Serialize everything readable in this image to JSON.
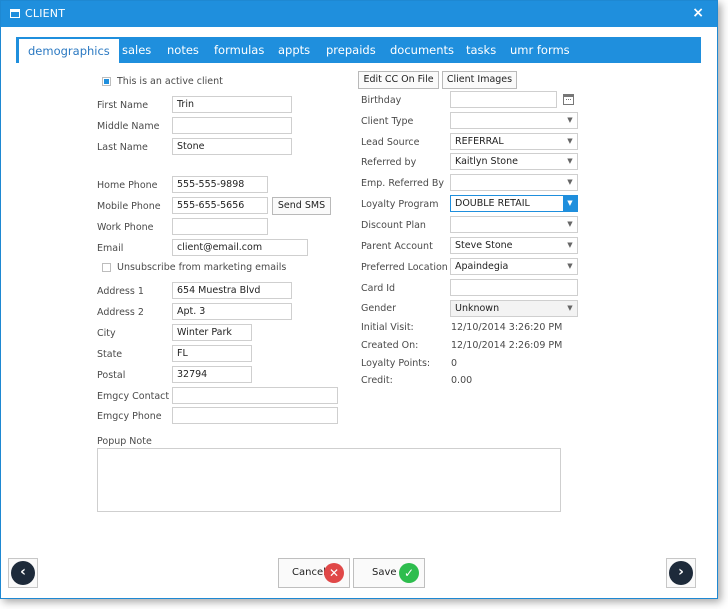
{
  "window": {
    "title": "CLIENT",
    "close": "×"
  },
  "tabs": [
    "demographics",
    "sales",
    "notes",
    "formulas",
    "appts",
    "prepaids",
    "documents",
    "tasks",
    "umr forms"
  ],
  "left": {
    "active_client": "This is an active client",
    "first_name_label": "First Name",
    "first_name": "Trin",
    "middle_name_label": "Middle Name",
    "middle_name": "",
    "last_name_label": "Last Name",
    "last_name": "Stone",
    "home_phone_label": "Home Phone",
    "home_phone": "555-555-9898",
    "mobile_phone_label": "Mobile Phone",
    "mobile_phone": "555-655-5656",
    "send_sms": "Send SMS",
    "work_phone_label": "Work Phone",
    "work_phone": "",
    "email_label": "Email",
    "email": "client@email.com",
    "unsubscribe": "Unsubscribe from marketing emails",
    "address1_label": "Address 1",
    "address1": "654 Muestra Blvd",
    "address2_label": "Address 2",
    "address2": "Apt. 3",
    "city_label": "City",
    "city": "Winter Park",
    "state_label": "State",
    "state": "FL",
    "postal_label": "Postal",
    "postal": "32794",
    "emgcy_contact_label": "Emgcy Contact",
    "emgcy_contact": "",
    "emgcy_phone_label": "Emgcy Phone",
    "emgcy_phone": "",
    "popup_note_label": "Popup Note"
  },
  "right": {
    "edit_cc": "Edit CC On File",
    "client_images": "Client Images",
    "birthday_label": "Birthday",
    "birthday": "",
    "client_type_label": "Client Type",
    "client_type": "",
    "lead_source_label": "Lead Source",
    "lead_source": "REFERRAL",
    "referred_by_label": "Referred by",
    "referred_by": "Kaitlyn Stone",
    "emp_referred_label": "Emp. Referred By",
    "emp_referred": "",
    "loyalty_program_label": "Loyalty Program",
    "loyalty_program": "DOUBLE RETAIL",
    "discount_plan_label": "Discount Plan",
    "discount_plan": "",
    "parent_account_label": "Parent Account",
    "parent_account": "Steve Stone",
    "preferred_location_label": "Preferred Location",
    "preferred_location": "Apaindegia",
    "card_id_label": "Card Id",
    "card_id": "",
    "gender_label": "Gender",
    "gender": "Unknown",
    "initial_visit_label": "Initial Visit:",
    "initial_visit": "12/10/2014 3:26:20 PM",
    "created_on_label": "Created On:",
    "created_on": "12/10/2014 2:26:09 PM",
    "loyalty_points_label": "Loyalty Points:",
    "loyalty_points": "0",
    "credit_label": "Credit:",
    "credit": "0.00"
  },
  "footer": {
    "cancel": "Cancel",
    "save": "Save"
  },
  "colors": {
    "accent": "#1f8fdd",
    "cancel": "#e04848",
    "save": "#2ebd4e",
    "nav": "#1d2a3a"
  }
}
